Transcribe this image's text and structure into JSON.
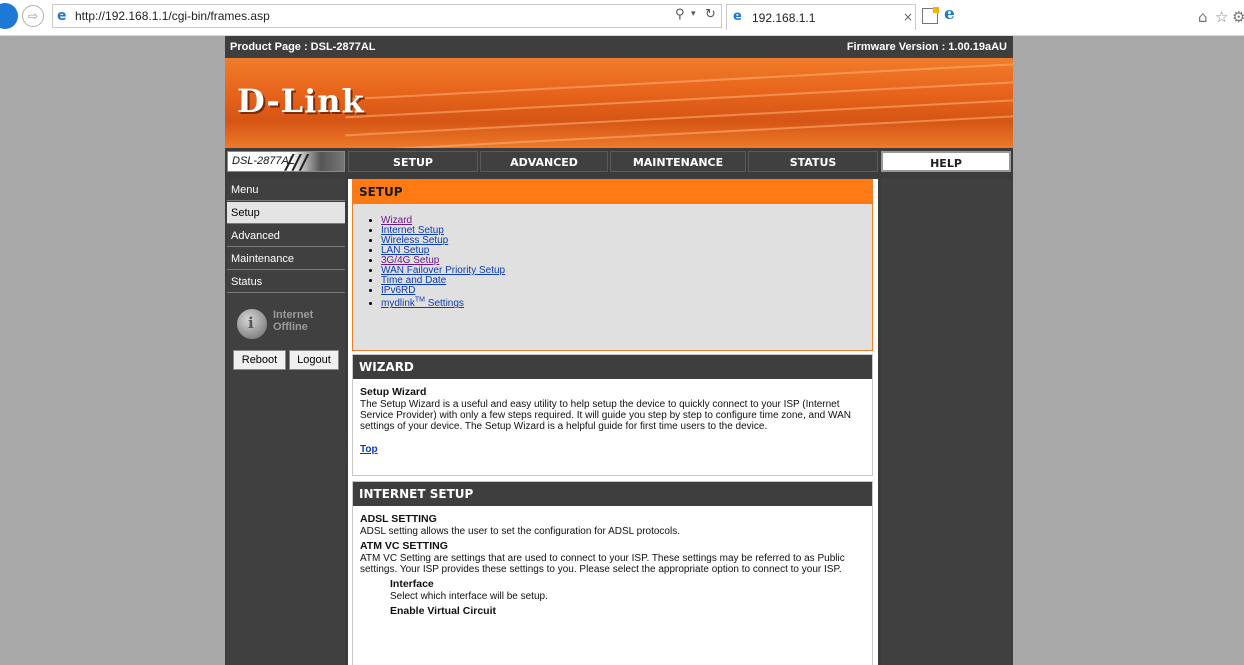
{
  "browser": {
    "url": "http://192.168.1.1/cgi-bin/frames.asp",
    "tab_title": "192.168.1.1",
    "tab_close": "×",
    "search_icon": "⚲",
    "dropdown_icon": "▾",
    "refresh_icon": "↻",
    "ie_icon": "e",
    "edge_icon": "e",
    "forward_icon": "⇨",
    "home_icon": "⌂",
    "star_icon": "☆",
    "settings_icon": "⚙"
  },
  "header": {
    "product_page": "Product Page : DSL-2877AL",
    "firmware": "Firmware Version : 1.00.19aAU",
    "logo": "D-Link",
    "model": "DSL-2877AL",
    "model_slashes": "///"
  },
  "nav": {
    "setup": "SETUP",
    "advanced": "ADVANCED",
    "maintenance": "MAINTENANCE",
    "status": "STATUS",
    "help": "HELP"
  },
  "sidebar": {
    "menu": "Menu",
    "setup": "Setup",
    "advanced": "Advanced",
    "maintenance": "Maintenance",
    "status": "Status",
    "internet_line1": "Internet",
    "internet_line2": "Offline",
    "reboot": "Reboot",
    "logout": "Logout"
  },
  "setup_section": {
    "title": "SETUP",
    "links": {
      "wizard": "Wizard",
      "internet": "Internet Setup",
      "wireless": "Wireless Setup",
      "lan": "LAN Setup",
      "g3g4": "3G/4G Setup",
      "wan_failover": "WAN Failover Priority Setup",
      "time": "Time and Date",
      "ipv6rd": "IPv6RD",
      "mydlink": "mydlink",
      "mydlink_tm": "TM",
      "mydlink_suffix": " Settings"
    }
  },
  "wizard_section": {
    "title": "WIZARD",
    "subtitle": "Setup Wizard",
    "body": "The Setup Wizard is a useful and easy utility to help setup the device to quickly connect to your ISP (Internet Service Provider) with only a few steps required. It will guide you step by step to configure time zone, and WAN settings of your device. The Setup Wizard is a helpful guide for first time users to the device.",
    "top": "Top"
  },
  "internet_section": {
    "title": "INTERNET SETUP",
    "adsl_title": "ADSL SETTING",
    "adsl_body": "ADSL setting allows the user to set the configuration for ADSL protocols.",
    "atm_title": "ATM VC SETTING",
    "atm_body": "ATM VC Setting are settings that are used to connect to your ISP. These settings may be referred to as Public settings. Your ISP provides these settings to you. Please select the appropriate option to connect to your ISP.",
    "interface_title": "Interface",
    "interface_body": "Select which interface will be setup.",
    "enable_vc_title": "Enable Virtual Circuit"
  },
  "colors": {
    "accent_orange": "#ff7a12",
    "nav_dark": "#3c3c3c",
    "link_blue": "#0b3db8",
    "link_visited": "#6b1a8e",
    "page_gray": "#a8a8a8"
  }
}
